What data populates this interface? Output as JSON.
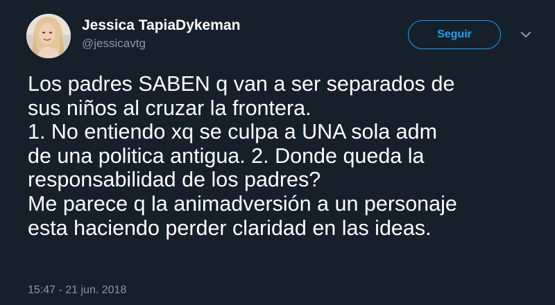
{
  "author": {
    "display_name": "Jessica TapiaDykeman",
    "handle": "@jessicavtg",
    "avatar_icon": "profile-photo"
  },
  "actions": {
    "follow_label": "Seguir",
    "more_icon": "chevron-down-icon"
  },
  "tweet": {
    "lines": [
      "Los padres SABEN q van a ser separados de",
      "sus niños al cruzar la frontera.",
      "1. No entiendo xq se culpa a UNA sola adm",
      "de una politica antigua. 2. Donde queda la",
      "responsabilidad de los padres?",
      "Me parece q la animadversión a un personaje",
      "esta haciendo perder claridad en las ideas."
    ],
    "timestamp": "15:47 - 21 jun. 2018"
  },
  "colors": {
    "background": "#15202b",
    "accent": "#1da1f2",
    "secondary_text": "#8899a6",
    "primary_text": "#ffffff"
  }
}
